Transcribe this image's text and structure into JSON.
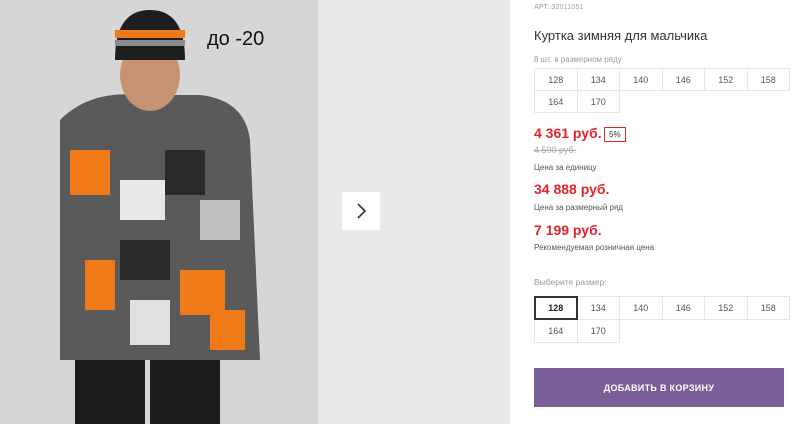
{
  "product": {
    "article": "АРТ.:32011051",
    "title": "Куртка зимняя для мальчика",
    "image_overlay": "до -20"
  },
  "set_sizes": {
    "note": "8 шт. в размерном ряду",
    "sizes": [
      "128",
      "134",
      "140",
      "146",
      "152",
      "158",
      "164",
      "170"
    ]
  },
  "pricing": {
    "unit_price": "4 361 руб.",
    "discount_badge": "5%",
    "old_price": "4 590 руб.",
    "unit_caption": "Цена за единицу",
    "set_price": "34 888 руб.",
    "set_caption": "Цена за размерный ряд",
    "retail_price": "7 199 руб.",
    "retail_caption": "Рекомендуемая розничная цена"
  },
  "size_picker": {
    "label": "Выберите размер:",
    "sizes": [
      "128",
      "134",
      "140",
      "146",
      "152",
      "158",
      "164",
      "170"
    ],
    "selected": "128"
  },
  "cart_button": "ДОБАВИТЬ В КОРЗИНУ",
  "colors": {
    "price": "#e3262b",
    "button": "#7a5e9a"
  }
}
